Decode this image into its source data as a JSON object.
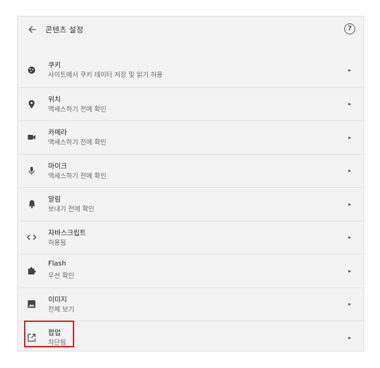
{
  "header": {
    "back_icon": "arrow-left-icon",
    "title": "콘텐츠 설정",
    "help_icon": "help-circle-icon",
    "help_glyph": "?"
  },
  "settings": [
    {
      "id": "cookies",
      "icon": "cookie-icon",
      "label": "쿠키",
      "sublabel": "사이트에서 쿠키 데이터 저장 및 읽기 허용"
    },
    {
      "id": "location",
      "icon": "location-pin-icon",
      "label": "위치",
      "sublabel": "액세스하기 전에 확인"
    },
    {
      "id": "camera",
      "icon": "camera-icon",
      "label": "카메라",
      "sublabel": "액세스하기 전에 확인"
    },
    {
      "id": "microphone",
      "icon": "microphone-icon",
      "label": "마이크",
      "sublabel": "액세스하기 전에 확인"
    },
    {
      "id": "notifications",
      "icon": "bell-icon",
      "label": "알림",
      "sublabel": "보내기 전에 확인"
    },
    {
      "id": "javascript",
      "icon": "code-icon",
      "label": "자바스크립트",
      "sublabel": "허용됨"
    },
    {
      "id": "flash",
      "icon": "puzzle-icon",
      "label": "Flash",
      "sublabel": "우선 확인"
    },
    {
      "id": "images",
      "icon": "image-icon",
      "label": "이미지",
      "sublabel": "전체 보기"
    },
    {
      "id": "popups",
      "icon": "open-in-new-icon",
      "label": "팝업",
      "sublabel": "차단됨"
    }
  ],
  "highlight_color": "#d42020",
  "chevron_glyph": "▸"
}
